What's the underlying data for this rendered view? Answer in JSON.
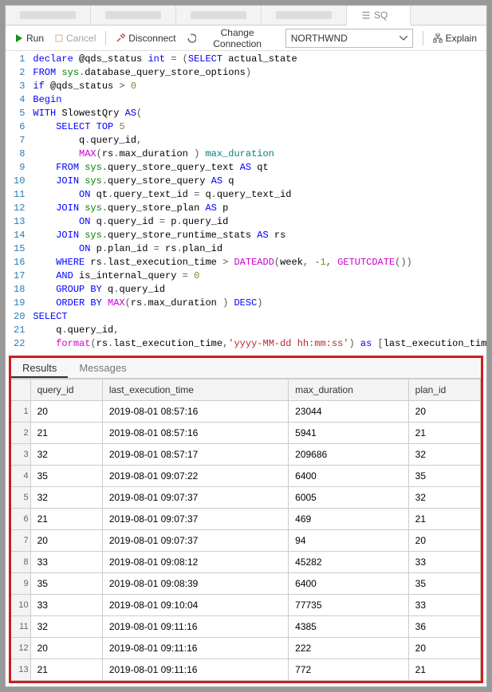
{
  "tabs": {
    "active": "SQ"
  },
  "toolbar": {
    "run": "Run",
    "cancel": "Cancel",
    "disconnect": "Disconnect",
    "change_connection": "Change Connection",
    "explain": "Explain"
  },
  "connection": {
    "selected": "NORTHWND"
  },
  "code": [
    {
      "n": 1,
      "h": "<span class='kw'>declare</span> @qds_status <span class='ty'>int</span> <span class='op'>=</span> <span class='op'>(</span><span class='kw'>SELECT</span> actual_state"
    },
    {
      "n": 2,
      "h": "<span class='kw'>FROM</span> <span class='sys'>sys</span><span class='op'>.</span>database_query_store_options<span class='op'>)</span>"
    },
    {
      "n": 3,
      "h": "<span class='kw'>if</span> @qds_status <span class='op'>&gt;</span> <span class='num'>0</span>"
    },
    {
      "n": 4,
      "h": "<span class='kw'>Begin</span>"
    },
    {
      "n": 5,
      "h": "<span class='kw'>WITH</span> SlowestQry <span class='kw'>AS</span><span class='op'>(</span>"
    },
    {
      "n": 6,
      "h": "    <span class='kw'>SELECT</span> <span class='kw'>TOP</span> <span class='num'>5</span>"
    },
    {
      "n": 7,
      "h": "        q<span class='op'>.</span>query_id<span class='op'>,</span>"
    },
    {
      "n": 8,
      "h": "        <span class='fn'>MAX</span><span class='op'>(</span>rs<span class='op'>.</span>max_duration <span class='op'>)</span> <span class='id2'>max_duration</span>"
    },
    {
      "n": 9,
      "h": "    <span class='kw'>FROM</span> <span class='sys'>sys</span><span class='op'>.</span>query_store_query_text <span class='kw'>AS</span> qt"
    },
    {
      "n": 10,
      "h": "    <span class='kw'>JOIN</span> <span class='sys'>sys</span><span class='op'>.</span>query_store_query <span class='kw'>AS</span> q"
    },
    {
      "n": 11,
      "h": "        <span class='kw'>ON</span> qt<span class='op'>.</span>query_text_id <span class='op'>=</span> q<span class='op'>.</span>query_text_id"
    },
    {
      "n": 12,
      "h": "    <span class='kw'>JOIN</span> <span class='sys'>sys</span><span class='op'>.</span>query_store_plan <span class='kw'>AS</span> p"
    },
    {
      "n": 13,
      "h": "        <span class='kw'>ON</span> q<span class='op'>.</span>query_id <span class='op'>=</span> p<span class='op'>.</span>query_id"
    },
    {
      "n": 14,
      "h": "    <span class='kw'>JOIN</span> <span class='sys'>sys</span><span class='op'>.</span>query_store_runtime_stats <span class='kw'>AS</span> rs"
    },
    {
      "n": 15,
      "h": "        <span class='kw'>ON</span> p<span class='op'>.</span>plan_id <span class='op'>=</span> rs<span class='op'>.</span>plan_id"
    },
    {
      "n": 16,
      "h": "    <span class='kw'>WHERE</span> rs<span class='op'>.</span>last_execution_time <span class='op'>&gt;</span> <span class='fn'>DATEADD</span><span class='op'>(</span>week<span class='op'>,</span> <span class='op'>-</span><span class='num'>1</span><span class='op'>,</span> <span class='fn'>GETUTCDATE</span><span class='op'>())</span>"
    },
    {
      "n": 17,
      "h": "    <span class='kw'>AND</span> is_internal_query <span class='op'>=</span> <span class='num'>0</span>"
    },
    {
      "n": 18,
      "h": "    <span class='kw'>GROUP BY</span> q<span class='op'>.</span>query_id"
    },
    {
      "n": 19,
      "h": "    <span class='kw'>ORDER BY</span> <span class='fn'>MAX</span><span class='op'>(</span>rs<span class='op'>.</span>max_duration <span class='op'>)</span> <span class='kw'>DESC</span><span class='op'>)</span>"
    },
    {
      "n": 20,
      "h": "<span class='kw'>SELECT</span>"
    },
    {
      "n": 21,
      "h": "    q<span class='op'>.</span>query_id<span class='op'>,</span>"
    },
    {
      "n": 22,
      "h": "    <span class='fn'>format</span><span class='op'>(</span>rs<span class='op'>.</span>last_execution_time<span class='op'>,</span><span class='str'>'yyyy-MM-dd hh:mm:ss'</span><span class='op'>)</span> <span class='kw'>as</span> <span class='op'>[</span>last_execution_time<span class='op'>]</span>"
    }
  ],
  "results": {
    "tabs": {
      "results": "Results",
      "messages": "Messages"
    },
    "columns": [
      "query_id",
      "last_execution_time",
      "max_duration",
      "plan_id"
    ],
    "rows": [
      {
        "n": 1,
        "query_id": "20",
        "last_execution_time": "2019-08-01 08:57:16",
        "max_duration": "23044",
        "plan_id": "20"
      },
      {
        "n": 2,
        "query_id": "21",
        "last_execution_time": "2019-08-01 08:57:16",
        "max_duration": "5941",
        "plan_id": "21"
      },
      {
        "n": 3,
        "query_id": "32",
        "last_execution_time": "2019-08-01 08:57:17",
        "max_duration": "209686",
        "plan_id": "32"
      },
      {
        "n": 4,
        "query_id": "35",
        "last_execution_time": "2019-08-01 09:07:22",
        "max_duration": "6400",
        "plan_id": "35"
      },
      {
        "n": 5,
        "query_id": "32",
        "last_execution_time": "2019-08-01 09:07:37",
        "max_duration": "6005",
        "plan_id": "32"
      },
      {
        "n": 6,
        "query_id": "21",
        "last_execution_time": "2019-08-01 09:07:37",
        "max_duration": "469",
        "plan_id": "21"
      },
      {
        "n": 7,
        "query_id": "20",
        "last_execution_time": "2019-08-01 09:07:37",
        "max_duration": "94",
        "plan_id": "20"
      },
      {
        "n": 8,
        "query_id": "33",
        "last_execution_time": "2019-08-01 09:08:12",
        "max_duration": "45282",
        "plan_id": "33"
      },
      {
        "n": 9,
        "query_id": "35",
        "last_execution_time": "2019-08-01 09:08:39",
        "max_duration": "6400",
        "plan_id": "35"
      },
      {
        "n": 10,
        "query_id": "33",
        "last_execution_time": "2019-08-01 09:10:04",
        "max_duration": "77735",
        "plan_id": "33"
      },
      {
        "n": 11,
        "query_id": "32",
        "last_execution_time": "2019-08-01 09:11:16",
        "max_duration": "4385",
        "plan_id": "36"
      },
      {
        "n": 12,
        "query_id": "20",
        "last_execution_time": "2019-08-01 09:11:16",
        "max_duration": "222",
        "plan_id": "20"
      },
      {
        "n": 13,
        "query_id": "21",
        "last_execution_time": "2019-08-01 09:11:16",
        "max_duration": "772",
        "plan_id": "21"
      }
    ]
  }
}
